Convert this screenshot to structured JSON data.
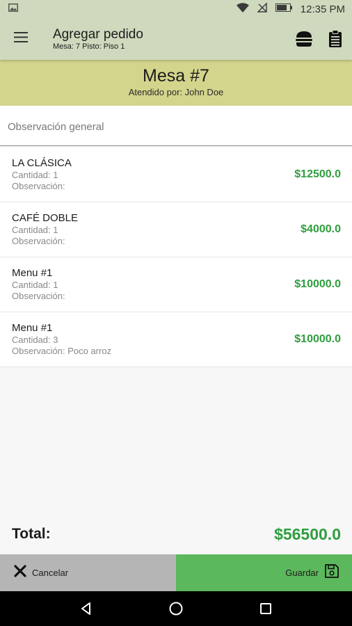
{
  "status_bar": {
    "time": "12:35 PM"
  },
  "app_bar": {
    "title": "Agregar pedido",
    "subtitle": "Mesa: 7 Pisto: Piso 1"
  },
  "banner": {
    "title": "Mesa #7",
    "served_by": "Atendido por: John Doe"
  },
  "observation": {
    "placeholder": "Observación general",
    "value": ""
  },
  "items": [
    {
      "name": "LA CLÁSICA",
      "quantity": "Cantidad: 1",
      "observation": "Observación:",
      "price": "$12500.0"
    },
    {
      "name": "CAFÉ DOBLE",
      "quantity": "Cantidad: 1",
      "observation": "Observación:",
      "price": "$4000.0"
    },
    {
      "name": "Menu #1",
      "quantity": "Cantidad: 1",
      "observation": "Observación:",
      "price": "$10000.0"
    },
    {
      "name": "Menu #1",
      "quantity": "Cantidad: 3",
      "observation": "Observación: Poco arroz",
      "price": "$10000.0"
    }
  ],
  "total": {
    "label": "Total:",
    "value": "$56500.0"
  },
  "buttons": {
    "cancel_label": "Cancelar",
    "save_label": "Guardar"
  },
  "colors": {
    "app_bar": "#cfd9bd",
    "banner": "#d3d58c",
    "price_green": "#2e9e3e",
    "save_button": "#5cb85c",
    "cancel_button": "#b5b5b5"
  },
  "icons": {
    "status_left": "image-icon",
    "status_right": [
      "wifi-icon",
      "signal-off-icon",
      "battery-icon"
    ],
    "app_bar": [
      "menu-icon",
      "burger-icon",
      "clipboard-icon"
    ],
    "buttons": [
      "close-icon",
      "save-icon"
    ],
    "nav": [
      "back-icon",
      "home-icon",
      "recents-icon"
    ]
  }
}
